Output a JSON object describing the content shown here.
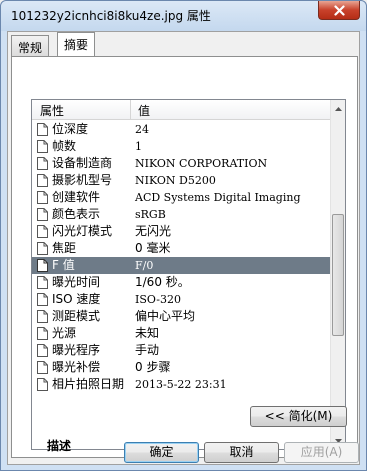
{
  "window": {
    "title": "101232y2icnhci8i8ku4ze.jpg 属性"
  },
  "tabs": [
    {
      "label": "常规"
    },
    {
      "label": "摘要"
    }
  ],
  "list": {
    "headers": {
      "property": "属性",
      "value": "值"
    },
    "rows": [
      {
        "name": "位深度",
        "value": "24"
      },
      {
        "name": "帧数",
        "value": "1"
      },
      {
        "name": "设备制造商",
        "value": "NIKON CORPORATION"
      },
      {
        "name": "摄影机型号",
        "value": "NIKON D5200"
      },
      {
        "name": "创建软件",
        "value": "ACD Systems Digital Imaging"
      },
      {
        "name": "颜色表示",
        "value": "sRGB"
      },
      {
        "name": "闪光灯模式",
        "value": "无闪光"
      },
      {
        "name": "焦距",
        "value": "0 毫米"
      },
      {
        "name": "F 值",
        "value": "F/0"
      },
      {
        "name": "曝光时间",
        "value": "1/60 秒。"
      },
      {
        "name": "ISO 速度",
        "value": "ISO-320"
      },
      {
        "name": "测距模式",
        "value": "偏中心平均"
      },
      {
        "name": "光源",
        "value": "未知"
      },
      {
        "name": "曝光程序",
        "value": "手动"
      },
      {
        "name": "曝光补偿",
        "value": "0 步骤"
      },
      {
        "name": "相片拍照日期",
        "value": "2013-5-22 23:31"
      }
    ],
    "section": "描述"
  },
  "buttons": {
    "simplify": "<< 简化(M)",
    "ok": "确定",
    "cancel": "取消",
    "apply": "应用(A)"
  }
}
